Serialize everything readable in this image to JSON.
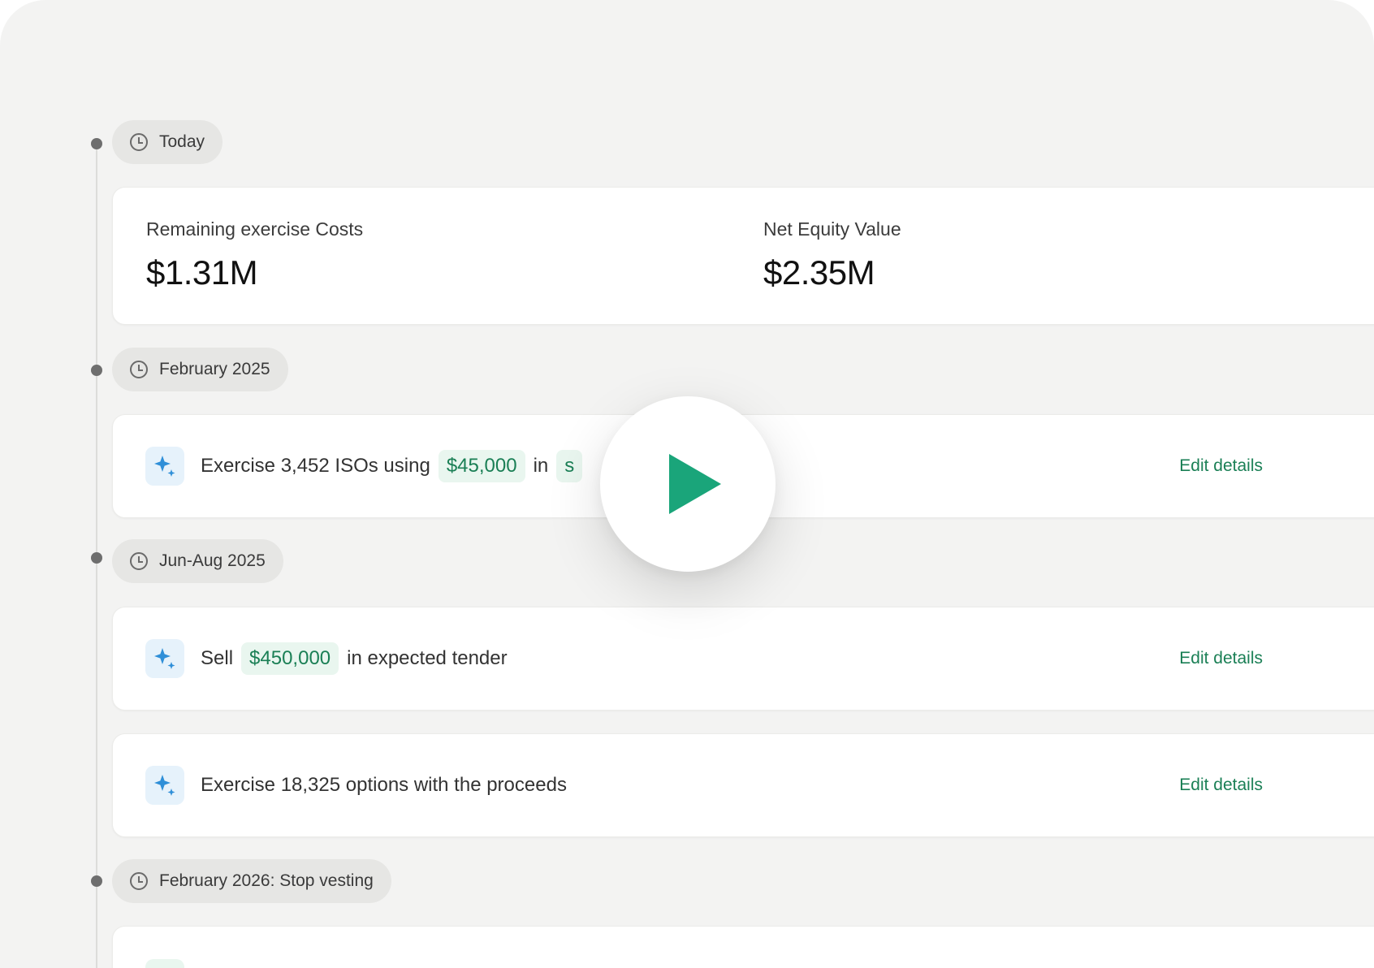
{
  "timeline": {
    "stages": [
      {
        "label": "Today"
      },
      {
        "label": "February 2025"
      },
      {
        "label": "Jun-Aug 2025"
      },
      {
        "label": "February 2026: Stop vesting"
      }
    ],
    "summary": {
      "remaining_label": "Remaining exercise Costs",
      "remaining_value": "$1.31M",
      "net_label": "Net Equity Value",
      "net_value": "$2.35M"
    },
    "actions": [
      {
        "prefix": "Exercise 3,452 ISOs using",
        "chip": "$45,000",
        "suffix": "in",
        "chip2": "s",
        "edit": "Edit details"
      },
      {
        "prefix": "Sell",
        "chip": "$450,000",
        "suffix": "in expected tender",
        "edit": "Edit details"
      },
      {
        "text": "Exercise 18,325 options with the proceeds",
        "edit": "Edit details"
      }
    ]
  },
  "colors": {
    "accent_green": "#1aa57a",
    "link_green": "#1a7f55",
    "chip_bg": "#e9f6ef",
    "sparkle_blue": "#2f8fd8"
  },
  "icons": {
    "stage": "clock-icon",
    "action": "sparkle-icon",
    "video": "play-icon"
  }
}
